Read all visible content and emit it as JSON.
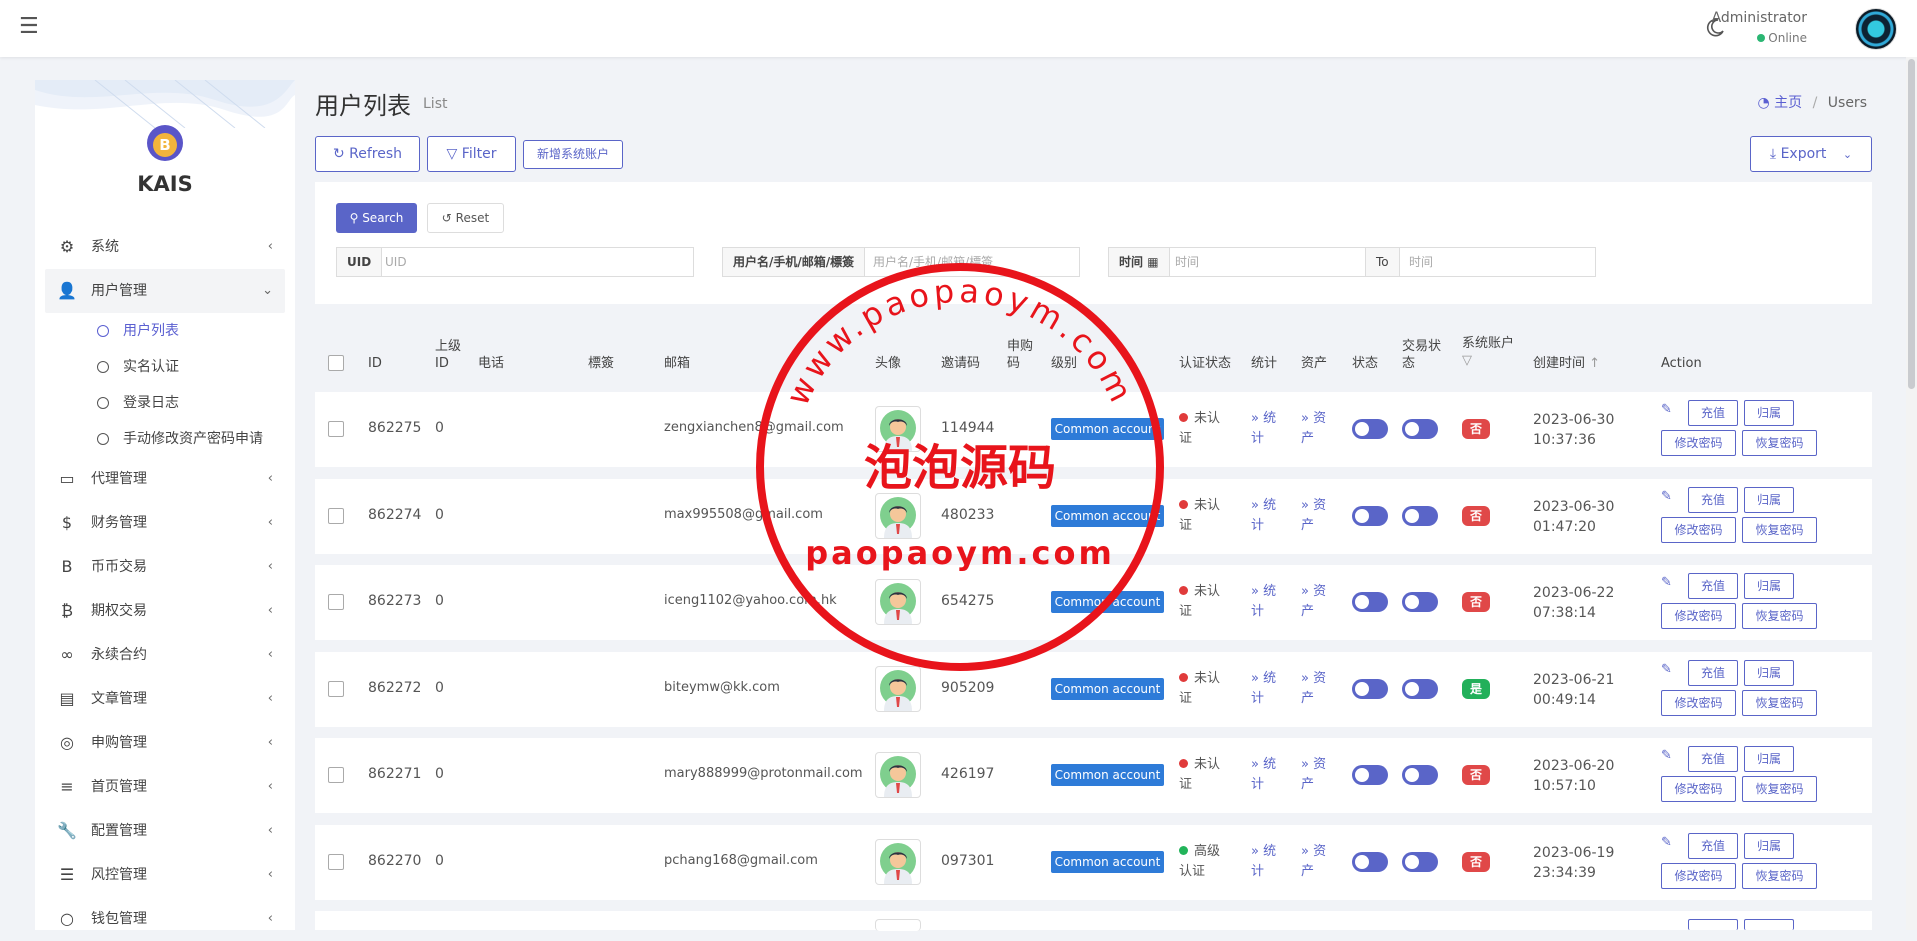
{
  "topbar": {
    "menu_icon": "hamburger-icon",
    "user_name": "Administrator",
    "user_status": "Online"
  },
  "sidebar": {
    "brand": "KAIS",
    "logo_letter": "B",
    "items": [
      {
        "label": "系统",
        "icon": "gear-icon",
        "glyph": "⚙"
      },
      {
        "label": "用户管理",
        "icon": "user-icon",
        "glyph": "👤",
        "open": true,
        "children": [
          "用户列表",
          "实名认证",
          "登录日志",
          "手动修改资产密码申请"
        ]
      },
      {
        "label": "代理管理",
        "icon": "id-card-icon",
        "glyph": "▭"
      },
      {
        "label": "财务管理",
        "icon": "dollar-icon",
        "glyph": "$"
      },
      {
        "label": "币币交易",
        "icon": "bitcoin-b-icon",
        "glyph": "B"
      },
      {
        "label": "期权交易",
        "icon": "bitcoin-icon",
        "glyph": "₿"
      },
      {
        "label": "永续合约",
        "icon": "link-icon",
        "glyph": "∞"
      },
      {
        "label": "文章管理",
        "icon": "newspaper-icon",
        "glyph": "▤"
      },
      {
        "label": "申购管理",
        "icon": "lifebuoy-icon",
        "glyph": "◎"
      },
      {
        "label": "首页管理",
        "icon": "list-icon",
        "glyph": "≡"
      },
      {
        "label": "配置管理",
        "icon": "wrench-icon",
        "glyph": "🔧"
      },
      {
        "label": "风控管理",
        "icon": "indent-icon",
        "glyph": "☰"
      },
      {
        "label": "钱包管理",
        "icon": "circle-icon",
        "glyph": "○"
      }
    ]
  },
  "page": {
    "title": "用户列表",
    "subtitle": "List",
    "breadcrumb_home": "主页",
    "breadcrumb_sep": "/",
    "breadcrumb_current": "Users"
  },
  "toolbar": {
    "refresh": "Refresh",
    "filter": "Filter",
    "add_account": "新增系统账户",
    "export": "Export"
  },
  "search": {
    "search_btn": "Search",
    "reset_btn": "Reset",
    "uid_label": "UID",
    "uid_placeholder": "UID",
    "name_label": "用户名/手机/邮箱/標簽",
    "name_placeholder": "用户名/手机/邮箱/標簽",
    "time_label": "时间",
    "time_placeholder": "时间",
    "to_label": "To",
    "to_placeholder": "时间"
  },
  "table": {
    "headers": {
      "id": "ID",
      "parent_a": "上级",
      "parent_b": "ID",
      "phone": "电话",
      "tag": "標簽",
      "email": "邮箱",
      "avatar": "头像",
      "invite": "邀请码",
      "apply_a": "申购",
      "apply_b": "码",
      "level": "级别",
      "verify": "认证状态",
      "stats": "统计",
      "assets": "资产",
      "status": "状态",
      "trade_a": "交易状",
      "trade_b": "态",
      "sys": "系统账户",
      "created": "创建时间",
      "action": "Action"
    },
    "rows": [
      {
        "id": "862275",
        "parent": "0",
        "email": "zengxianchen8@gmail.com",
        "invite": "114944",
        "level": "Common account",
        "verify_a": "未认",
        "verify_b": "证",
        "verified": false,
        "sys": "否",
        "date": "2023-06-30",
        "time": "10:37:36"
      },
      {
        "id": "862274",
        "parent": "0",
        "email": "max995508@gmail.com",
        "invite": "480233",
        "level": "Common account",
        "verify_a": "未认",
        "verify_b": "证",
        "verified": false,
        "sys": "否",
        "date": "2023-06-30",
        "time": "01:47:20"
      },
      {
        "id": "862273",
        "parent": "0",
        "email": "iceng1102@yahoo.com.hk",
        "invite": "654275",
        "level": "Common account",
        "verify_a": "未认",
        "verify_b": "证",
        "verified": false,
        "sys": "否",
        "date": "2023-06-22",
        "time": "07:38:14"
      },
      {
        "id": "862272",
        "parent": "0",
        "email": "biteymw@kk.com",
        "invite": "905209",
        "level": "Common account",
        "verify_a": "未认",
        "verify_b": "证",
        "verified": false,
        "sys": "是",
        "date": "2023-06-21",
        "time": "00:49:14"
      },
      {
        "id": "862271",
        "parent": "0",
        "email": "mary888999@protonmail.com",
        "invite": "426197",
        "level": "Common account",
        "verify_a": "未认",
        "verify_b": "证",
        "verified": false,
        "sys": "否",
        "date": "2023-06-20",
        "time": "10:57:10"
      },
      {
        "id": "862270",
        "parent": "0",
        "email": "pchang168@gmail.com",
        "invite": "097301",
        "level": "Common account",
        "verify_a": "高级",
        "verify_b": "认证",
        "verified": true,
        "sys": "否",
        "date": "2023-06-19",
        "time": "23:34:39"
      }
    ],
    "link_stats_a": "» 统",
    "link_stats_b": "计",
    "link_assets_a": "» 资",
    "link_assets_b": "产",
    "action_recharge": "充值",
    "action_belong": "归属",
    "action_change_pwd": "修改密码",
    "action_reset_pwd": "恢复密码"
  },
  "watermark": {
    "top_text": "www.paopaoym.com",
    "center_text": "泡泡源码",
    "bottom_text": "paopaoym.com"
  },
  "colors": {
    "accent": "#5a65c8",
    "level_blue": "#2e7bd8",
    "no_red": "#e04848",
    "yes_green": "#22b05a",
    "stamp_red": "#e8141b"
  }
}
